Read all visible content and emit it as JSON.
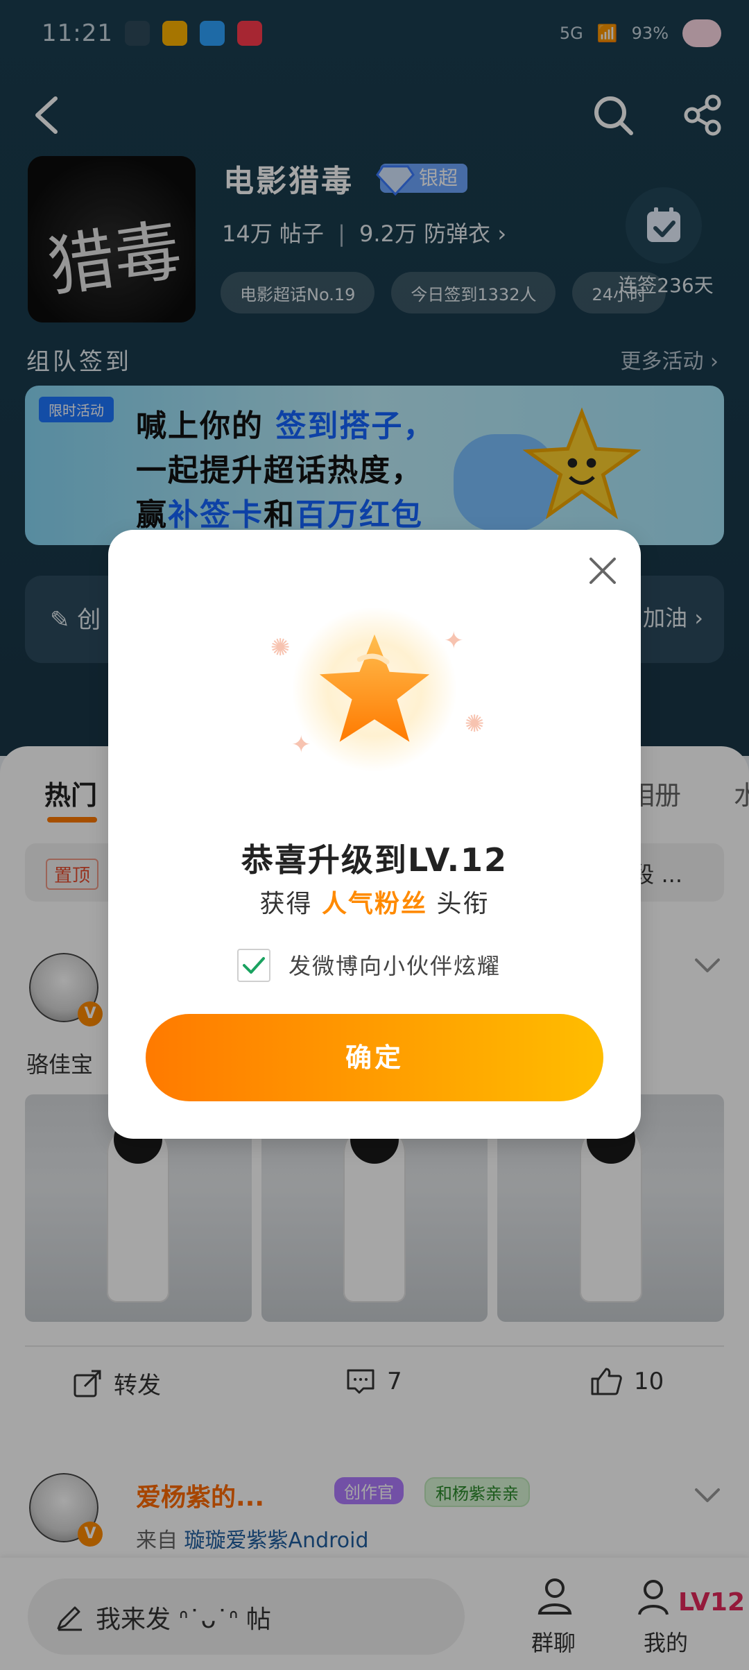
{
  "status_bar": {
    "time": "11:21",
    "battery": "93%",
    "network": "5G"
  },
  "header": {
    "back_icon": "back-arrow-icon",
    "search_icon": "search-icon",
    "share_icon": "share-icon",
    "topic_title": "电影猎毒",
    "super_badge": "银超",
    "posts_count": "14万",
    "posts_label": "帖子",
    "fans_count": "9.2万",
    "fans_label": "防弹衣",
    "chips": [
      "电影超话No.19",
      "今日签到1332人",
      "24小时"
    ],
    "checkin_label": "连签236天",
    "cover_glyph": "猎毒"
  },
  "activity": {
    "section_title": "组队签到",
    "more_label": "更多活动",
    "banner_tag": "限时活动",
    "banner_line1_pre": "喊上你的",
    "banner_line1_hl": "签到搭子，",
    "banner_line2": "一起提升超话热度，",
    "banner_line3_pre": "赢",
    "banner_line3_hl1": "补签卡",
    "banner_line3_mid": "和",
    "banner_line3_hl2": "百万红包"
  },
  "hero_row": {
    "left": "创",
    "right": "加油"
  },
  "tabs": {
    "hot": "热门",
    "album": "相册",
    "more": "水"
  },
  "pinned": {
    "tag": "置顶",
    "text": "段 ..."
  },
  "post1": {
    "author": "骆佳宝",
    "repost_label": "转发",
    "comments": "7",
    "likes": "10"
  },
  "post2": {
    "name": "爱杨紫的...",
    "badge1": "创作官",
    "badge2": "和杨紫亲亲",
    "from_prefix": "来自",
    "from_source": "璇璇爱紫紫Android"
  },
  "bottom": {
    "compose": "我来发 ᐢ˙ᴗ˙ᐢ 帖",
    "group_chat": "群聊",
    "mine": "我的",
    "level": "LV12"
  },
  "dialog": {
    "title": "恭喜升级到LV.12",
    "sub_pre": "获得",
    "sub_hl": "人气粉丝",
    "sub_post": "头衔",
    "checkbox_label": "发微博向小伙伴炫耀",
    "confirm": "确定"
  },
  "colors": {
    "accent_orange": "#ff8a00",
    "header_bg": "#1b3e50",
    "super_badge": "#6ea7ff"
  }
}
